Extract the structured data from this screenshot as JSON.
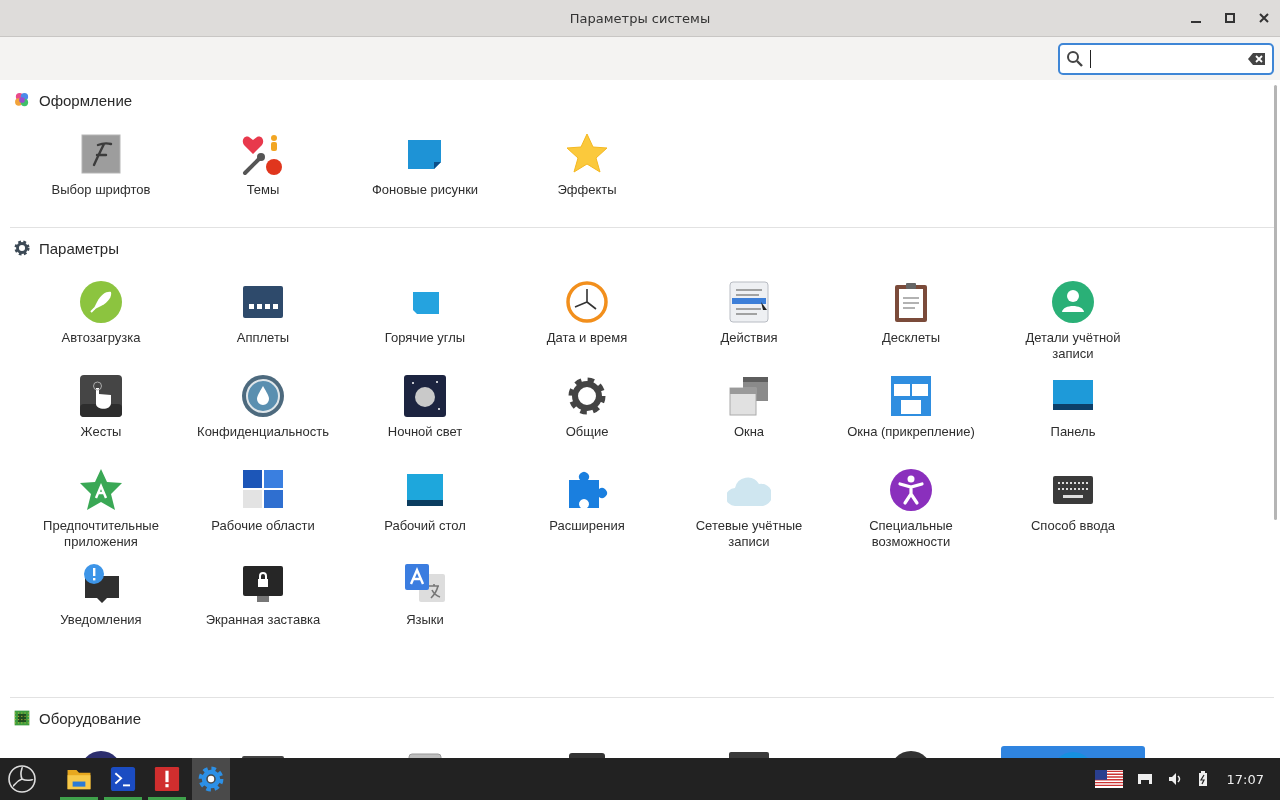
{
  "window": {
    "title": "Параметры системы"
  },
  "sections": [
    {
      "title": "Оформление",
      "items": [
        {
          "label": "Выбор шрифтов",
          "selected": false
        },
        {
          "label": "Темы",
          "selected": false
        },
        {
          "label": "Фоновые рисунки",
          "selected": false
        },
        {
          "label": "Эффекты",
          "selected": false
        }
      ]
    },
    {
      "title": "Параметры",
      "items": [
        {
          "label": "Автозагрузка",
          "selected": false
        },
        {
          "label": "Апплеты",
          "selected": false
        },
        {
          "label": "Горячие углы",
          "selected": false
        },
        {
          "label": "Дата и время",
          "selected": false
        },
        {
          "label": "Действия",
          "selected": false
        },
        {
          "label": "Десклеты",
          "selected": false
        },
        {
          "label": "Детали учётной записи",
          "selected": false
        },
        {
          "label": "Жесты",
          "selected": false
        },
        {
          "label": "Конфиденциальность",
          "selected": false
        },
        {
          "label": "Ночной свет",
          "selected": false
        },
        {
          "label": "Общие",
          "selected": false
        },
        {
          "label": "Окна",
          "selected": false
        },
        {
          "label": "Окна (прикрепление)",
          "selected": false
        },
        {
          "label": "Панель",
          "selected": false
        },
        {
          "label": "Предпочтительные приложения",
          "selected": false
        },
        {
          "label": "Рабочие области",
          "selected": false
        },
        {
          "label": "Рабочий стол",
          "selected": false
        },
        {
          "label": "Расширения",
          "selected": false
        },
        {
          "label": "Сетевые учётные записи",
          "selected": false
        },
        {
          "label": "Специальные возможности",
          "selected": false
        },
        {
          "label": "Способ ввода",
          "selected": false
        },
        {
          "label": "Уведомления",
          "selected": false
        },
        {
          "label": "Экранная заставка",
          "selected": false
        },
        {
          "label": "Языки",
          "selected": false
        }
      ]
    },
    {
      "title": "Оборудование",
      "items": [
        {
          "selected": false
        },
        {
          "selected": false
        },
        {
          "selected": false
        },
        {
          "selected": false
        },
        {
          "selected": false
        },
        {
          "selected": false
        },
        {
          "selected": true
        }
      ]
    }
  ],
  "taskbar": {
    "apps": [
      {
        "running": true,
        "selected": false
      },
      {
        "running": true,
        "selected": false
      },
      {
        "running": true,
        "selected": false
      },
      {
        "running": false,
        "selected": true
      }
    ],
    "clock": "17:07"
  }
}
